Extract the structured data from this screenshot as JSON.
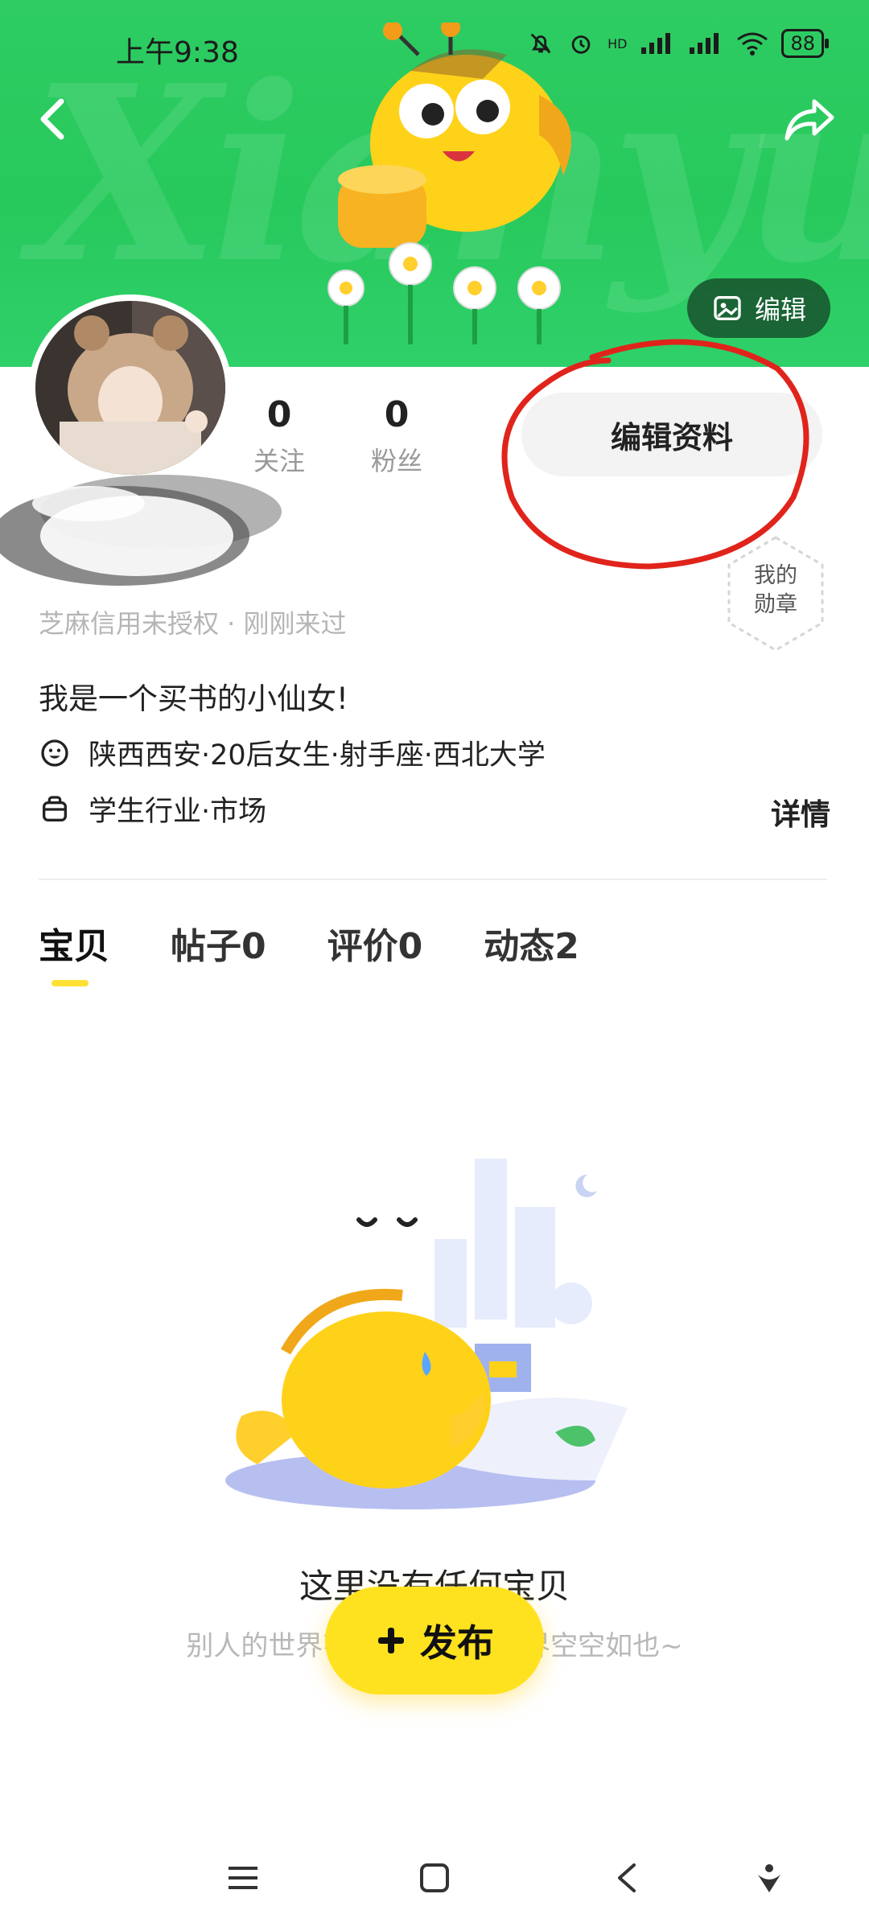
{
  "status_bar": {
    "time": "上午9:38",
    "network_label": "HD",
    "battery": "88"
  },
  "banner": {
    "watermark_text": "Xianyu",
    "edit_cover_label": "编辑"
  },
  "profile": {
    "following_count": "0",
    "following_label": "关注",
    "followers_count": "0",
    "followers_label": "粉丝",
    "edit_profile_label": "编辑资料",
    "sesame_text": "芝麻信用未授权 · 刚刚来过",
    "badge_label_line1": "我的",
    "badge_label_line2": "勋章",
    "bio": "我是一个买书的小仙女!",
    "info_line1": "陕西西安·20后女生·射手座·西北大学",
    "info_line2": "学生行业·市场",
    "detail_label": "详情"
  },
  "tabs": [
    {
      "label": "宝贝"
    },
    {
      "label": "帖子0"
    },
    {
      "label": "评价0"
    },
    {
      "label": "动态2"
    }
  ],
  "empty_state": {
    "title": "这里没有任何宝贝",
    "subtitle": "别人的世界花花绿绿,我的世界空空如也~"
  },
  "publish": {
    "label": "发布",
    "icon": "plus-icon"
  },
  "colors": {
    "banner_green": "#2ecc63",
    "accent_yellow": "#ffe21f",
    "annotation_red": "#e0241b"
  }
}
